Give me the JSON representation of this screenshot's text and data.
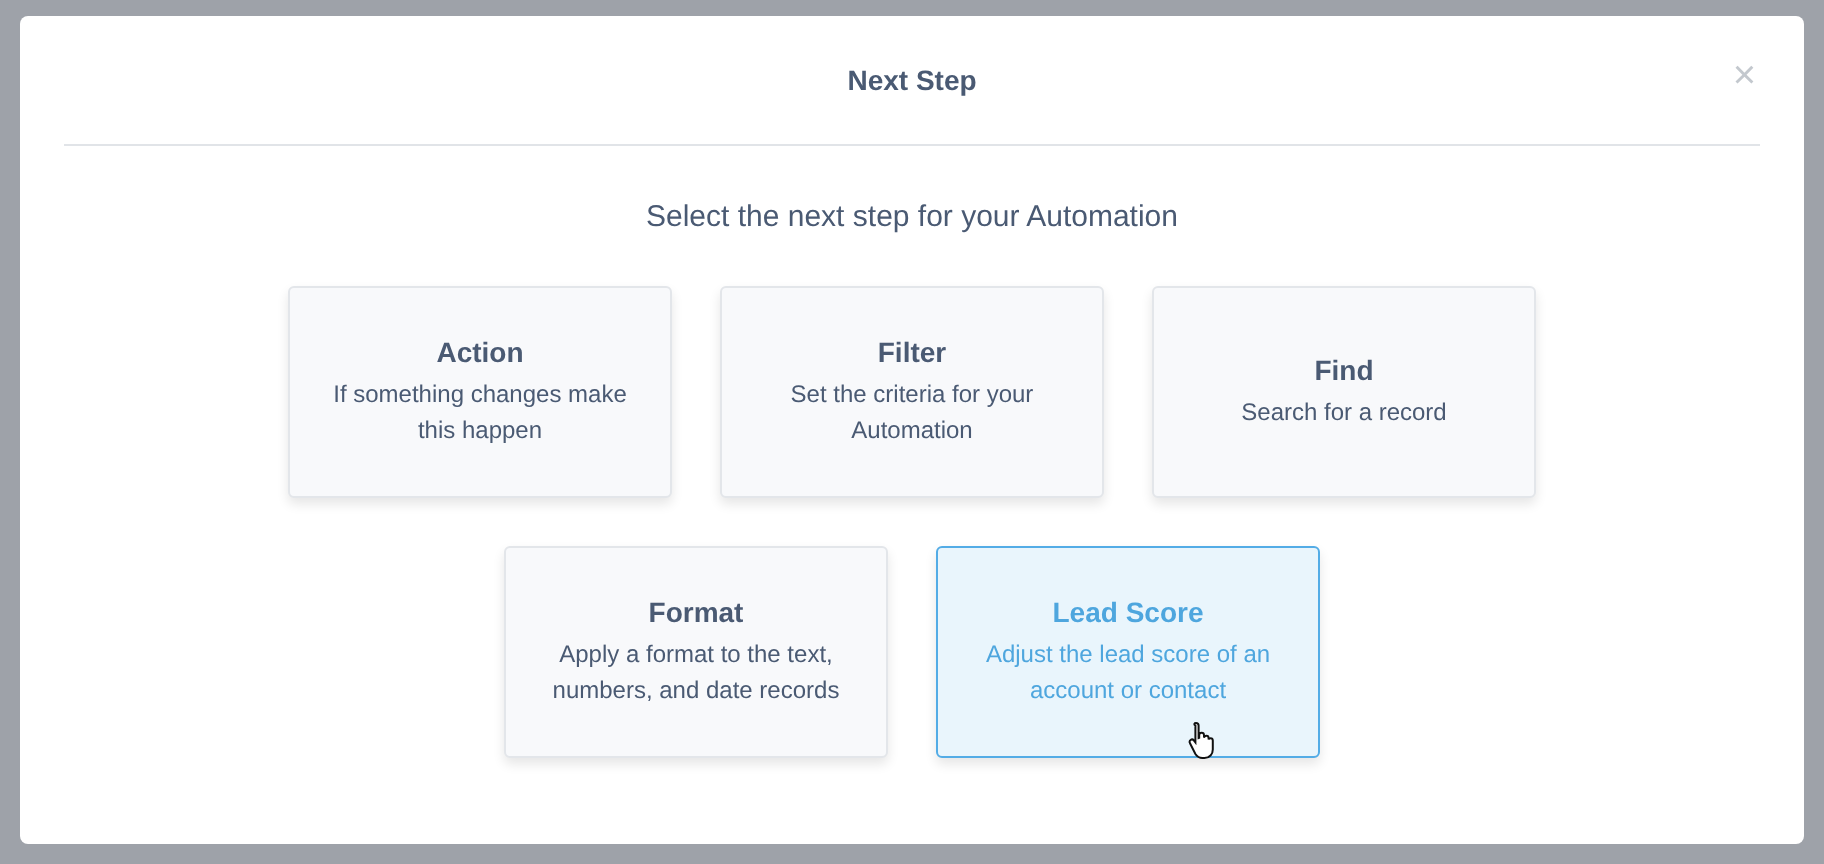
{
  "dialog": {
    "title": "Next Step",
    "close": "×",
    "prompt": "Select the next step for your Automation"
  },
  "steps": [
    {
      "title": "Action",
      "description": "If something changes make this happen",
      "selected": false
    },
    {
      "title": "Filter",
      "description": "Set the criteria for your Automation",
      "selected": false
    },
    {
      "title": "Find",
      "description": "Search for a record",
      "selected": false
    },
    {
      "title": "Format",
      "description": "Apply a format to the text, numbers, and date records",
      "selected": false
    },
    {
      "title": "Lead Score",
      "description": "Adjust the lead score of an account or contact",
      "selected": true
    }
  ]
}
